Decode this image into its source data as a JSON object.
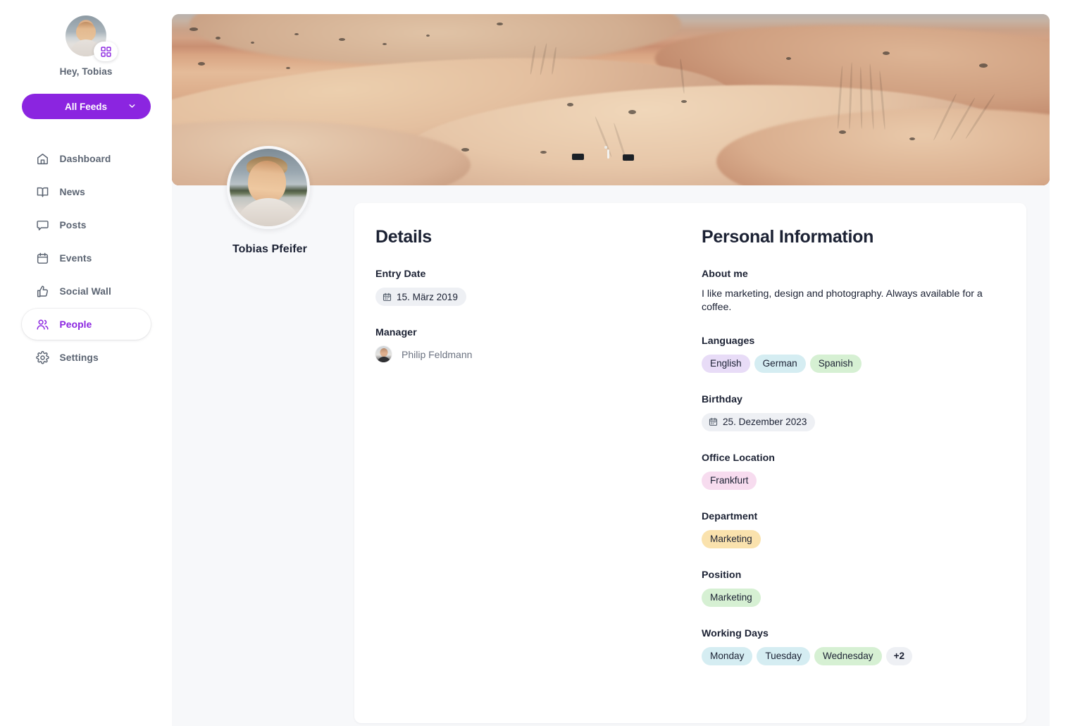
{
  "sidebar": {
    "greeting": "Hey, Tobias",
    "feeds_button": {
      "label": "All Feeds",
      "icon": "chevron-down-icon"
    },
    "avatar_badge_icon": "apps-grid-icon",
    "nav": [
      {
        "label": "Dashboard",
        "icon": "home-icon",
        "active": false
      },
      {
        "label": "News",
        "icon": "book-open-icon",
        "active": false
      },
      {
        "label": "Posts",
        "icon": "message-icon",
        "active": false
      },
      {
        "label": "Events",
        "icon": "calendar-icon",
        "active": false
      },
      {
        "label": "Social Wall",
        "icon": "thumbs-up-icon",
        "active": false
      },
      {
        "label": "People",
        "icon": "users-icon",
        "active": true
      },
      {
        "label": "Settings",
        "icon": "gear-icon",
        "active": false
      }
    ]
  },
  "profile": {
    "name": "Tobias Pfeifer",
    "banner_alt": "desert-dunes-banner"
  },
  "details": {
    "title": "Details",
    "entry_date": {
      "label": "Entry Date",
      "value": "15. März 2019",
      "icon": "calendar-icon"
    },
    "manager": {
      "label": "Manager",
      "name": "Philip Feldmann"
    }
  },
  "personal": {
    "title": "Personal Information",
    "about": {
      "label": "About me",
      "text": "I like marketing, design and photography. Always available for a coffee."
    },
    "languages": {
      "label": "Languages",
      "items": [
        {
          "text": "English",
          "color": "purple"
        },
        {
          "text": "German",
          "color": "cyan"
        },
        {
          "text": "Spanish",
          "color": "green"
        }
      ]
    },
    "birthday": {
      "label": "Birthday",
      "value": "25. Dezember 2023",
      "icon": "calendar-icon"
    },
    "office_location": {
      "label": "Office Location",
      "items": [
        {
          "text": "Frankfurt",
          "color": "pink"
        }
      ]
    },
    "department": {
      "label": "Department",
      "items": [
        {
          "text": "Marketing",
          "color": "amber"
        }
      ]
    },
    "position": {
      "label": "Position",
      "items": [
        {
          "text": "Marketing",
          "color": "green"
        }
      ]
    },
    "working_days": {
      "label": "Working Days",
      "items": [
        {
          "text": "Monday",
          "color": "cyan"
        },
        {
          "text": "Tuesday",
          "color": "cyan"
        },
        {
          "text": "Wednesday",
          "color": "green"
        },
        {
          "text": "+2",
          "color": "gray"
        }
      ]
    }
  },
  "colors": {
    "accent": "#8B25E0",
    "text_dark": "#1b2133",
    "text_muted": "#5b6472",
    "page_bg": "#f7f8fa",
    "card_bg": "#ffffff"
  }
}
